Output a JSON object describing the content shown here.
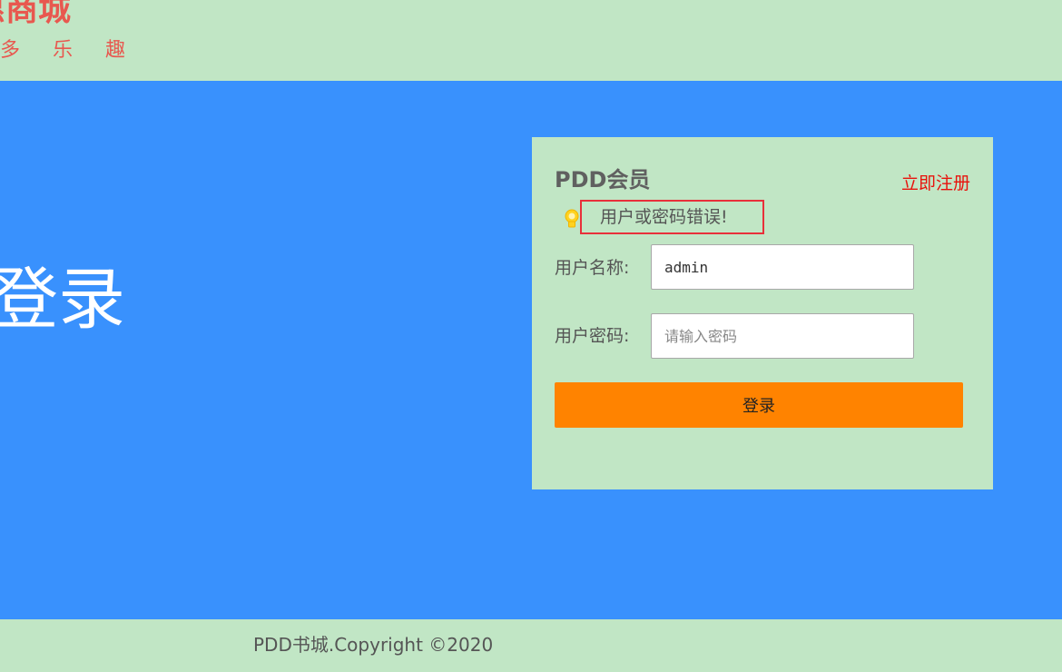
{
  "header": {
    "logo_title": "惠商城",
    "logo_slogan": "多乐趣"
  },
  "banner": {
    "title": "登录"
  },
  "login_form": {
    "title": "PDD会员",
    "register_link": "立即注册",
    "hint_icon": "lightbulb-icon",
    "error_message": "用户或密码错误!",
    "username_label": "用户名称:",
    "username_value": "admin",
    "password_label": "用户密码:",
    "password_placeholder": "请输入密码",
    "submit_label": "登录"
  },
  "footer": {
    "copyright": "PDD书城.Copyright ©2020"
  },
  "colors": {
    "header_bg": "#c1e6c5",
    "banner_bg": "#3991fd",
    "button_bg": "#ff8300",
    "error_border": "#e8303a",
    "brand_red": "#e8584f"
  }
}
